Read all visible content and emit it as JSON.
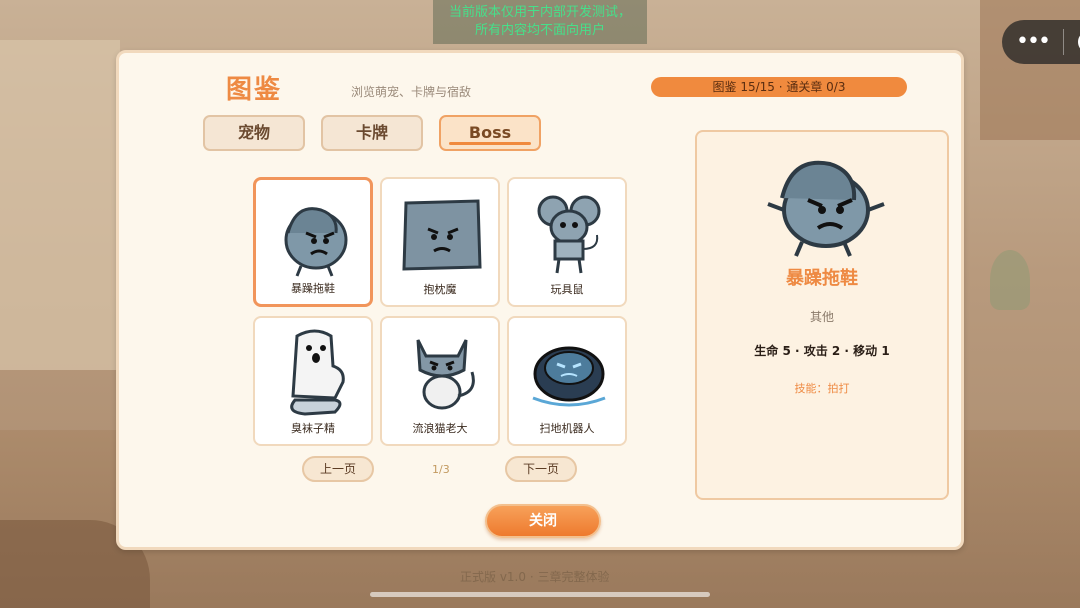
{
  "debug_banner": {
    "line1": "当前版本仅用于内部开发测试，",
    "line2": "所有内容均不面向用户"
  },
  "capsule": {
    "more_icon": "more-dots-icon",
    "close_icon": "target-circle-icon"
  },
  "header": {
    "title": "图鉴",
    "subtitle": "浏览萌宠、卡牌与宿敌",
    "progress": "图鉴 15/15 · 通关章 0/3"
  },
  "tabs": [
    {
      "label": "宠物",
      "active": false
    },
    {
      "label": "卡牌",
      "active": false
    },
    {
      "label": "Boss",
      "active": true
    }
  ],
  "cards": [
    {
      "name": "暴躁拖鞋",
      "icon": "angry-slipper-icon",
      "selected": true
    },
    {
      "name": "抱枕魔",
      "icon": "pillow-monster-icon",
      "selected": false
    },
    {
      "name": "玩具鼠",
      "icon": "toy-mouse-icon",
      "selected": false
    },
    {
      "name": "臭袜子精",
      "icon": "sock-ghost-icon",
      "selected": false
    },
    {
      "name": "流浪猫老大",
      "icon": "stray-cat-boss-icon",
      "selected": false
    },
    {
      "name": "扫地机器人",
      "icon": "robot-vacuum-icon",
      "selected": false
    }
  ],
  "pager": {
    "prev": "上一页",
    "next": "下一页",
    "page": "1/3"
  },
  "close_label": "关闭",
  "detail": {
    "name": "暴躁拖鞋",
    "category": "其他",
    "stats": "生命 5 · 攻击 2 · 移动 1",
    "skill": "技能：拍打",
    "icon": "angry-slipper-icon"
  },
  "footer": {
    "version": "正式版 v1.0 · 三章完整体验"
  },
  "colors": {
    "accent": "#f08a3e",
    "title": "#ee8a43",
    "panel": "#fdf7ec"
  }
}
